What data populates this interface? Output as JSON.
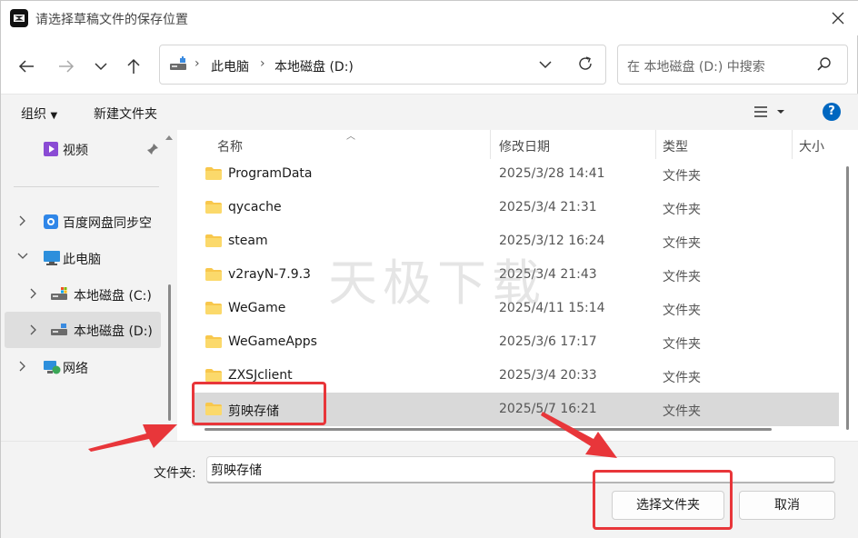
{
  "window": {
    "title": "请选择草稿文件的保存位置"
  },
  "address": {
    "crumbs": [
      "此电脑",
      "本地磁盘 (D:)"
    ]
  },
  "search": {
    "placeholder": "在 本地磁盘 (D:) 中搜索"
  },
  "commandbar": {
    "organize": "组织",
    "new_folder": "新建文件夹"
  },
  "sidebar": {
    "items": [
      {
        "label": "视频",
        "icon": "video-icon"
      },
      {
        "label": "百度网盘同步空",
        "icon": "baidu-netdisk-icon"
      },
      {
        "label": "此电脑",
        "icon": "pc-icon"
      },
      {
        "label": "本地磁盘 (C:)",
        "icon": "drive-icon"
      },
      {
        "label": "本地磁盘 (D:)",
        "icon": "drive-icon"
      },
      {
        "label": "网络",
        "icon": "network-icon"
      }
    ]
  },
  "columns": {
    "name": "名称",
    "date": "修改日期",
    "type": "类型",
    "size": "大小"
  },
  "files": [
    {
      "name": "ProgramData",
      "date": "2025/3/28 14:41",
      "type": "文件夹"
    },
    {
      "name": "qycache",
      "date": "2025/3/4 21:31",
      "type": "文件夹"
    },
    {
      "name": "steam",
      "date": "2025/3/12 16:24",
      "type": "文件夹"
    },
    {
      "name": "v2rayN-7.9.3",
      "date": "2025/3/4 21:43",
      "type": "文件夹"
    },
    {
      "name": "WeGame",
      "date": "2025/4/11 15:14",
      "type": "文件夹"
    },
    {
      "name": "WeGameApps",
      "date": "2025/3/6 17:17",
      "type": "文件夹"
    },
    {
      "name": "ZXSJclient",
      "date": "2025/3/4 20:33",
      "type": "文件夹"
    },
    {
      "name": "剪映存储",
      "date": "2025/5/7 16:21",
      "type": "文件夹"
    }
  ],
  "watermark": "天极下载",
  "footer": {
    "folder_label": "文件夹:",
    "folder_value": "剪映存储",
    "select_button": "选择文件夹",
    "cancel_button": "取消"
  },
  "colors": {
    "accent": "#0067c0",
    "annotation": "#e8363a",
    "folder": "#f8c74c"
  }
}
